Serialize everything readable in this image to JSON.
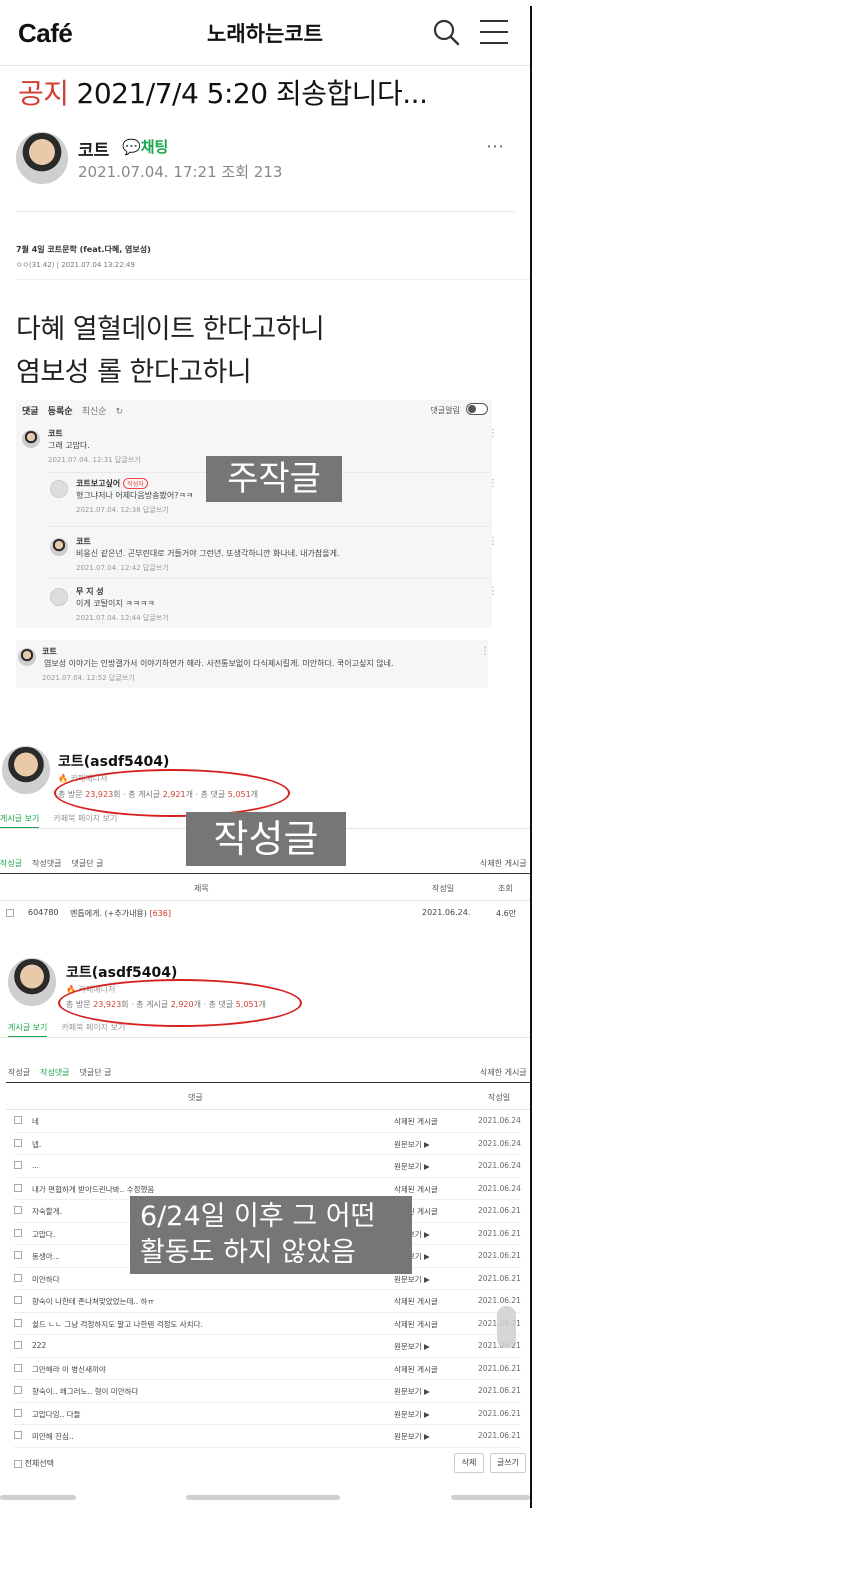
{
  "header": {
    "logo": "Café",
    "cafe_name": "노래하는코트"
  },
  "post": {
    "notice_label": "공지",
    "title": "2021/7/4 5:20 죄송합니다...",
    "author": "코트",
    "chat_label": "채팅",
    "meta": "2021.07.04. 17:21 조회 213",
    "more_icon": "⋯"
  },
  "original_post": {
    "title": "7월 4일 코트문학 (feat.다혜, 염보성)",
    "meta": "ㅇㅇ(31.42)  |  2021.07.04 13:22:49"
  },
  "body": {
    "line1": "다혜 열혈데이트 한다고하니",
    "line2": "염보성 롤 한다고하니"
  },
  "comments_box": {
    "header": "댓글",
    "sort": "등록순",
    "sort_alt": "최신순",
    "refresh_icon": "↻",
    "alarm": "댓글알림",
    "items": [
      {
        "name": "코트",
        "text": "그래 고맙다.",
        "meta": "2021.07.04. 12:31   답글쓰기"
      },
      {
        "name": "코트보고싶어",
        "badge": "작성자",
        "text": "형그냐저나 어제다음방송봤어?ㅋㅋ",
        "meta": "2021.07.04. 12:38   답글쓰기"
      },
      {
        "name": "코트",
        "text": "비응신 같은년. 곤부린대로 거들거야 그런년. 또생각하니깐 화나네. 내가참을게.",
        "meta": "2021.07.04. 12:42   답글쓰기"
      },
      {
        "name": "무 지 성",
        "text": "이게 코탈이지 ㅋㅋㅋㅋ",
        "meta": "2021.07.04. 12:44   답글쓰기"
      },
      {
        "name": "코트",
        "text": "염보성 이야기는 인방갤가서 이야기하면가 해라. 사전통보없이 다식제시킬게. 미안하다. 쿡이고싶지 않네.",
        "meta": "2021.07.04. 12:52   답글쓰기"
      }
    ]
  },
  "overlays": {
    "fabricated": "주작글",
    "written_posts": "작성글",
    "note_line1": "6/24일 이후 그 어떤",
    "note_line2": "활동도 하지 않았음"
  },
  "profile1": {
    "name": "코트(asdf5404)",
    "grade": "🔥 카페매니저",
    "visits_label": "총 방문 ",
    "visits": "23,923",
    "posts_label": "회 · 총 게시글 ",
    "posts": "2,921",
    "comments_label": "개 · 총 댓글 ",
    "comments": "5,051",
    "tail": "개",
    "tab_posts": "게시글 보기",
    "tab_page": "카페북 페이지 보기",
    "subtab1": "작성글",
    "subtab2": "작성댓글",
    "subtab3": "댓글단 글",
    "deleted": "삭제한 게시글",
    "col_title": "제목",
    "col_date": "작성일",
    "col_views": "조회",
    "row": {
      "id": "604780",
      "title": "멘톱에게. (+추가내용)",
      "count": "[636]",
      "date": "2021.06.24.",
      "views": "4.6만"
    }
  },
  "profile2": {
    "name": "코트(asdf5404)",
    "grade": "🔥 카페매니저",
    "visits_label": "총 방문 ",
    "visits": "23,923",
    "posts_label": "회 · 총 게시글 ",
    "posts": "2,920",
    "comments_label": "개 · 총 댓글 ",
    "comments": "5,051",
    "tail": "개",
    "tab_posts": "게시글 보기",
    "tab_page": "카페북 페이지 보기",
    "subtab1": "작성글",
    "subtab2": "작성댓글",
    "subtab3": "댓글단 글",
    "deleted": "삭제한 게시글",
    "col_comment": "댓글",
    "col_date": "작성일"
  },
  "comment_rows": [
    {
      "text": "네",
      "status": "삭제된 게시글",
      "date": "2021.06.24"
    },
    {
      "text": "넵.",
      "status": "원문보기 ▶",
      "date": "2021.06.24"
    },
    {
      "text": "...",
      "status": "원문보기 ▶",
      "date": "2021.06.24"
    },
    {
      "text": "내가 편협하게 받아드린나봐.. 수정했음",
      "status": "삭제된 게시글",
      "date": "2021.06.24"
    },
    {
      "text": "자숙할게.",
      "status": "삭제된 게시글",
      "date": "2021.06.21"
    },
    {
      "text": "고맙다.",
      "status": "원문보기 ▶",
      "date": "2021.06.21"
    },
    {
      "text": "동생아...",
      "status": "원문보기 ▶",
      "date": "2021.06.21"
    },
    {
      "text": "미안하다",
      "status": "원문보기 ▶",
      "date": "2021.06.21"
    },
    {
      "text": "향숙이 나한테 존나쳐맞았었는데.. 하ㅠ",
      "status": "삭제된 게시글",
      "date": "2021.06.21"
    },
    {
      "text": "쉴드 ㄴㄴ 그냥 걱정하지도 말고 나한텐 걱정도 사치다.",
      "status": "삭제된 게시글",
      "date": "2021.06.21"
    },
    {
      "text": "222",
      "status": "원문보기 ▶",
      "date": "2021.06.21"
    },
    {
      "text": "그만해라 이 병신새끼야",
      "status": "삭제된 게시글",
      "date": "2021.06.21"
    },
    {
      "text": "향숙이.. 왜그러노.. 형이 미안하다",
      "status": "원문보기 ▶",
      "date": "2021.06.21"
    },
    {
      "text": "고맙다잉.. 다들",
      "status": "원문보기 ▶",
      "date": "2021.06.21"
    },
    {
      "text": "미안해 진심..",
      "status": "원문보기 ▶",
      "date": "2021.06.21"
    }
  ],
  "footer": {
    "select_all": "전체선택",
    "delete": "삭제",
    "write": "글쓰기"
  },
  "colors": {
    "notice_red": "#d33c2f",
    "green": "#1aa64a",
    "ellipse_red": "#d71f1f",
    "overlay_gray": "#767676"
  }
}
